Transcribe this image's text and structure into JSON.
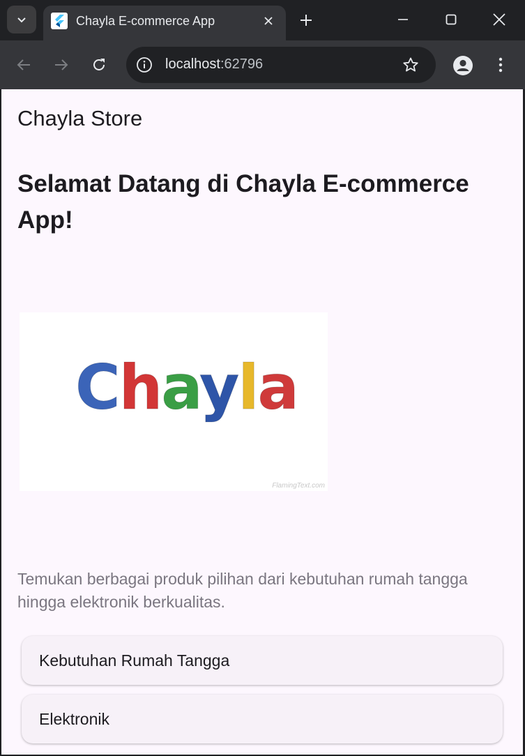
{
  "browser": {
    "tab_title": "Chayla E-commerce App",
    "url_host": "localhost",
    "url_port": ":62796"
  },
  "app": {
    "appbar_title": "Chayla Store",
    "welcome_heading": "Selamat Datang di Chayla E-commerce App!",
    "logo": {
      "letters": [
        {
          "char": "C",
          "color": "#3b64b8"
        },
        {
          "char": "h",
          "color": "#d23636"
        },
        {
          "char": "a",
          "color": "#3a9e45"
        },
        {
          "char": "y",
          "color": "#2e55a8"
        },
        {
          "char": "l",
          "color": "#e7b82b"
        },
        {
          "char": "a",
          "color": "#cf3a3a"
        }
      ],
      "watermark": "FlamingText.com"
    },
    "description": "Temukan berbagai produk pilihan dari kebutuhan rumah tangga hingga elektronik berkualitas.",
    "categories": [
      {
        "label": "Kebutuhan Rumah Tangga"
      },
      {
        "label": "Elektronik"
      }
    ]
  },
  "colors": {
    "page_background": "#fdf7fe",
    "tile_background": "#f7f1f8",
    "browser_frame": "#202124",
    "toolbar": "#35363a"
  }
}
